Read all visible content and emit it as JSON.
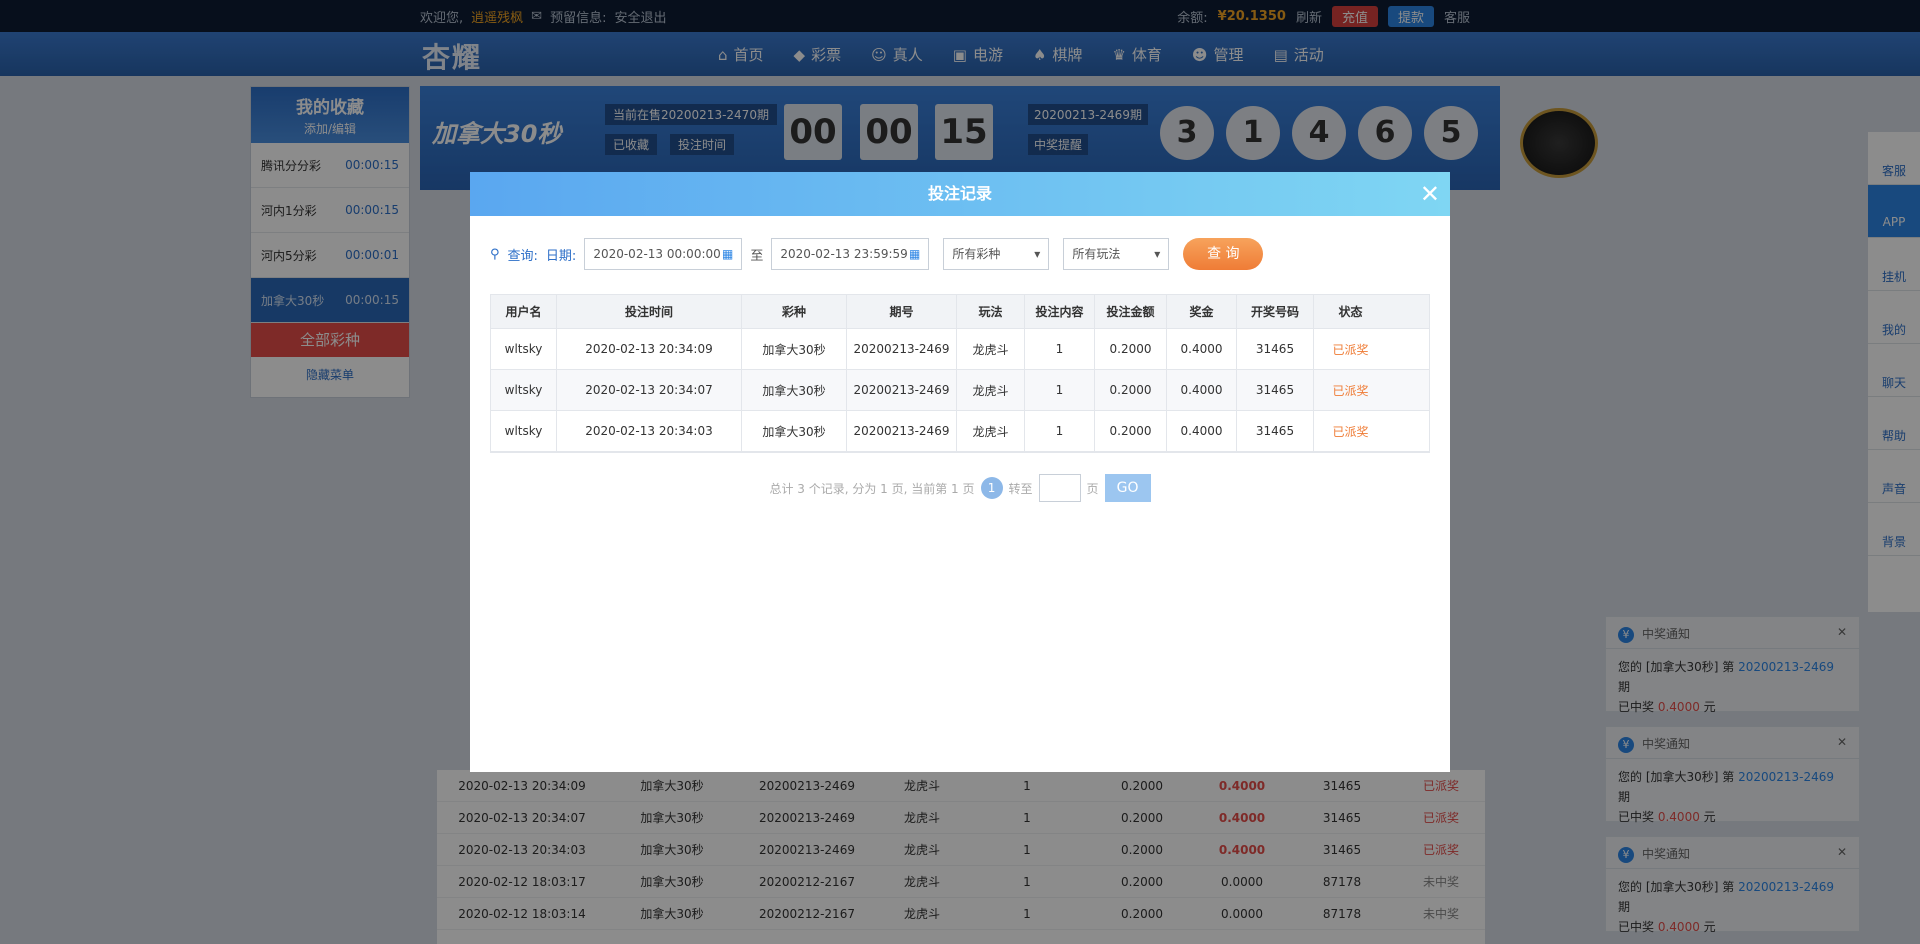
{
  "topbar": {
    "welcome": "欢迎您,",
    "username": "逍遥残枫",
    "reserved": "预留信息:",
    "logout": "安全退出",
    "balance_label": "余额:",
    "balance": "¥20.1350",
    "refresh": "刷新",
    "recharge": "充值",
    "withdraw": "提款",
    "service": "客服"
  },
  "nav": {
    "logo": "杏耀",
    "items": [
      "首页",
      "彩票",
      "真人",
      "电游",
      "棋牌",
      "体育",
      "管理",
      "活动"
    ]
  },
  "favorites": {
    "title": "我的收藏",
    "edit": "添加/编辑",
    "items": [
      {
        "name": "腾讯分分彩",
        "time": "00:00:15"
      },
      {
        "name": "河内1分彩",
        "time": "00:00:15"
      },
      {
        "name": "河内5分彩",
        "time": "00:00:01"
      },
      {
        "name": "加拿大30秒",
        "time": "00:00:15"
      }
    ],
    "all": "全部彩种",
    "hide": "隐藏菜单"
  },
  "lottery": {
    "name": "加拿大30秒",
    "current": "当前在售20200213-2470期",
    "collected": "已收藏",
    "bet_time": "投注时间",
    "countdown": [
      "00",
      "00",
      "15"
    ],
    "last_issue": "20200213-2469期",
    "remind": "中奖提醒",
    "balls": [
      "3",
      "1",
      "4",
      "6",
      "5"
    ]
  },
  "right_sidebar": [
    "客服",
    "APP",
    "挂机",
    "我的",
    "聊天",
    "帮助",
    "声音",
    "背景"
  ],
  "notifications": [
    {
      "title": "中奖通知",
      "pre": "您的 [加拿大30秒] 第",
      "issue": "20200213-2469",
      "post": "期",
      "line2": "已中奖",
      "amount": "0.4000",
      "unit": "元"
    },
    {
      "title": "中奖通知",
      "pre": "您的 [加拿大30秒] 第",
      "issue": "20200213-2469",
      "post": "期",
      "line2": "已中奖",
      "amount": "0.4000",
      "unit": "元"
    },
    {
      "title": "中奖通知",
      "pre": "您的 [加拿大30秒] 第",
      "issue": "20200213-2469",
      "post": "期",
      "line2": "已中奖",
      "amount": "0.4000",
      "unit": "元"
    }
  ],
  "bg_records": [
    [
      "2020-02-13 20:34:09",
      "加拿大30秒",
      "20200213-2469",
      "龙虎斗",
      "1",
      "0.2000",
      "0.4000",
      "31465",
      "已派奖"
    ],
    [
      "2020-02-13 20:34:07",
      "加拿大30秒",
      "20200213-2469",
      "龙虎斗",
      "1",
      "0.2000",
      "0.4000",
      "31465",
      "已派奖"
    ],
    [
      "2020-02-13 20:34:03",
      "加拿大30秒",
      "20200213-2469",
      "龙虎斗",
      "1",
      "0.2000",
      "0.4000",
      "31465",
      "已派奖"
    ],
    [
      "2020-02-12 18:03:17",
      "加拿大30秒",
      "20200212-2167",
      "龙虎斗",
      "1",
      "0.2000",
      "0.0000",
      "87178",
      "未中奖"
    ],
    [
      "2020-02-12 18:03:14",
      "加拿大30秒",
      "20200212-2167",
      "龙虎斗",
      "1",
      "0.2000",
      "0.0000",
      "87178",
      "未中奖"
    ]
  ],
  "modal": {
    "title": "投注记录",
    "query": "查询:",
    "date_label": "日期:",
    "date_from": "2020-02-13 00:00:00",
    "to": "至",
    "date_to": "2020-02-13 23:59:59",
    "lottery_select": "所有彩种",
    "play_select": "所有玩法",
    "query_btn": "查 询",
    "headers": [
      "用户名",
      "投注时间",
      "彩种",
      "期号",
      "玩法",
      "投注内容",
      "投注金额",
      "奖金",
      "开奖号码",
      "状态"
    ],
    "rows": [
      [
        "wltsky",
        "2020-02-13 20:34:09",
        "加拿大30秒",
        "20200213-2469",
        "龙虎斗",
        "1",
        "0.2000",
        "0.4000",
        "31465",
        "已派奖"
      ],
      [
        "wltsky",
        "2020-02-13 20:34:07",
        "加拿大30秒",
        "20200213-2469",
        "龙虎斗",
        "1",
        "0.2000",
        "0.4000",
        "31465",
        "已派奖"
      ],
      [
        "wltsky",
        "2020-02-13 20:34:03",
        "加拿大30秒",
        "20200213-2469",
        "龙虎斗",
        "1",
        "0.2000",
        "0.4000",
        "31465",
        "已派奖"
      ]
    ],
    "pager_text": "总计 3 个记录, 分为 1 页, 当前第 1 页",
    "page": "1",
    "jump": "转至",
    "page_unit": "页",
    "go": "GO"
  }
}
